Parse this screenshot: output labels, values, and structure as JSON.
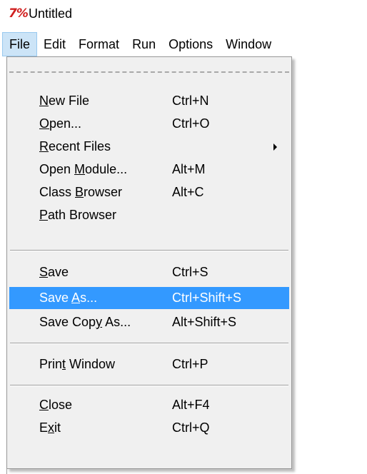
{
  "window": {
    "title": "Untitled",
    "icon": "idle-app-icon"
  },
  "menubar": [
    {
      "label": "File",
      "open": true
    },
    {
      "label": "Edit"
    },
    {
      "label": "Format"
    },
    {
      "label": "Run"
    },
    {
      "label": "Options"
    },
    {
      "label": "Window"
    }
  ],
  "file_menu": {
    "items": [
      {
        "label": "New File",
        "mnemonic": "N",
        "accel": "Ctrl+N"
      },
      {
        "label": "Open...",
        "mnemonic": "O",
        "accel": "Ctrl+O"
      },
      {
        "label": "Recent Files",
        "mnemonic": "R",
        "accel": "",
        "submenu": true
      },
      {
        "label": "Open Module...",
        "mnemonic": "M",
        "accel": "Alt+M"
      },
      {
        "label": "Class Browser",
        "mnemonic": "B",
        "accel": "Alt+C"
      },
      {
        "label": "Path Browser",
        "mnemonic": "P",
        "accel": ""
      },
      {
        "label": "Save",
        "mnemonic": "S",
        "accel": "Ctrl+S"
      },
      {
        "label": "Save As...",
        "mnemonic": "A",
        "accel": "Ctrl+Shift+S",
        "highlighted": true
      },
      {
        "label": "Save Copy As...",
        "mnemonic": "y",
        "accel": "Alt+Shift+S"
      },
      {
        "label": "Print Window",
        "mnemonic": "t",
        "accel": "Ctrl+P"
      },
      {
        "label": "Close",
        "mnemonic": "C",
        "accel": "Alt+F4"
      },
      {
        "label": "Exit",
        "mnemonic": "x",
        "accel": "Ctrl+Q"
      }
    ]
  },
  "colors": {
    "highlight": "#3399ff",
    "menu_bg": "#f0f0f0",
    "menubar_open_bg": "#cce4f7"
  }
}
